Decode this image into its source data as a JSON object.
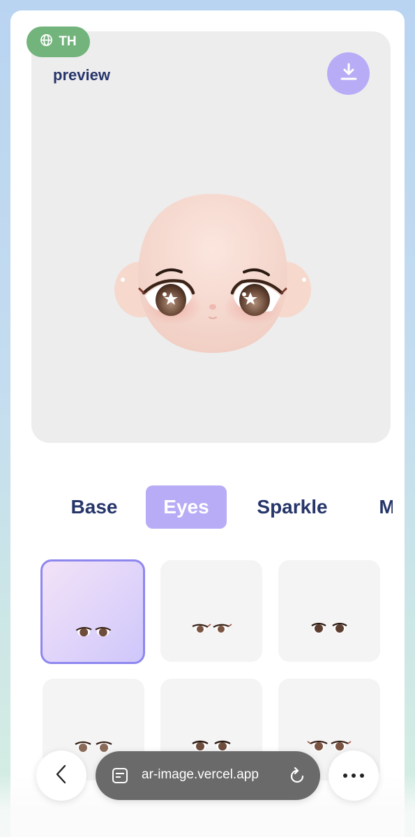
{
  "header": {
    "language_badge": "TH",
    "language_icon": "globe-icon",
    "preview_label": "preview",
    "download_icon": "download-icon"
  },
  "tabs": [
    {
      "label": "Base",
      "selected": false
    },
    {
      "label": "Eyes",
      "selected": true
    },
    {
      "label": "Sparkle",
      "selected": false
    },
    {
      "label": "M",
      "selected": false
    }
  ],
  "eye_options": {
    "selected_index": 0,
    "items": [
      "eyes-option-1",
      "eyes-option-2",
      "eyes-option-3",
      "eyes-option-4",
      "eyes-option-5",
      "eyes-option-6"
    ]
  },
  "browser_bar": {
    "back_icon": "chevron-left-icon",
    "tabs_icon": "tab-overview-icon",
    "url": "ar-image.vercel.app",
    "reload_icon": "reload-icon",
    "more_icon": "more-icon"
  },
  "colors": {
    "accent": "#b8acf6",
    "accent_border": "#8e87ee",
    "badge_green": "#73b47d",
    "text_navy": "#27366a",
    "skin": "#f6dcd3"
  }
}
